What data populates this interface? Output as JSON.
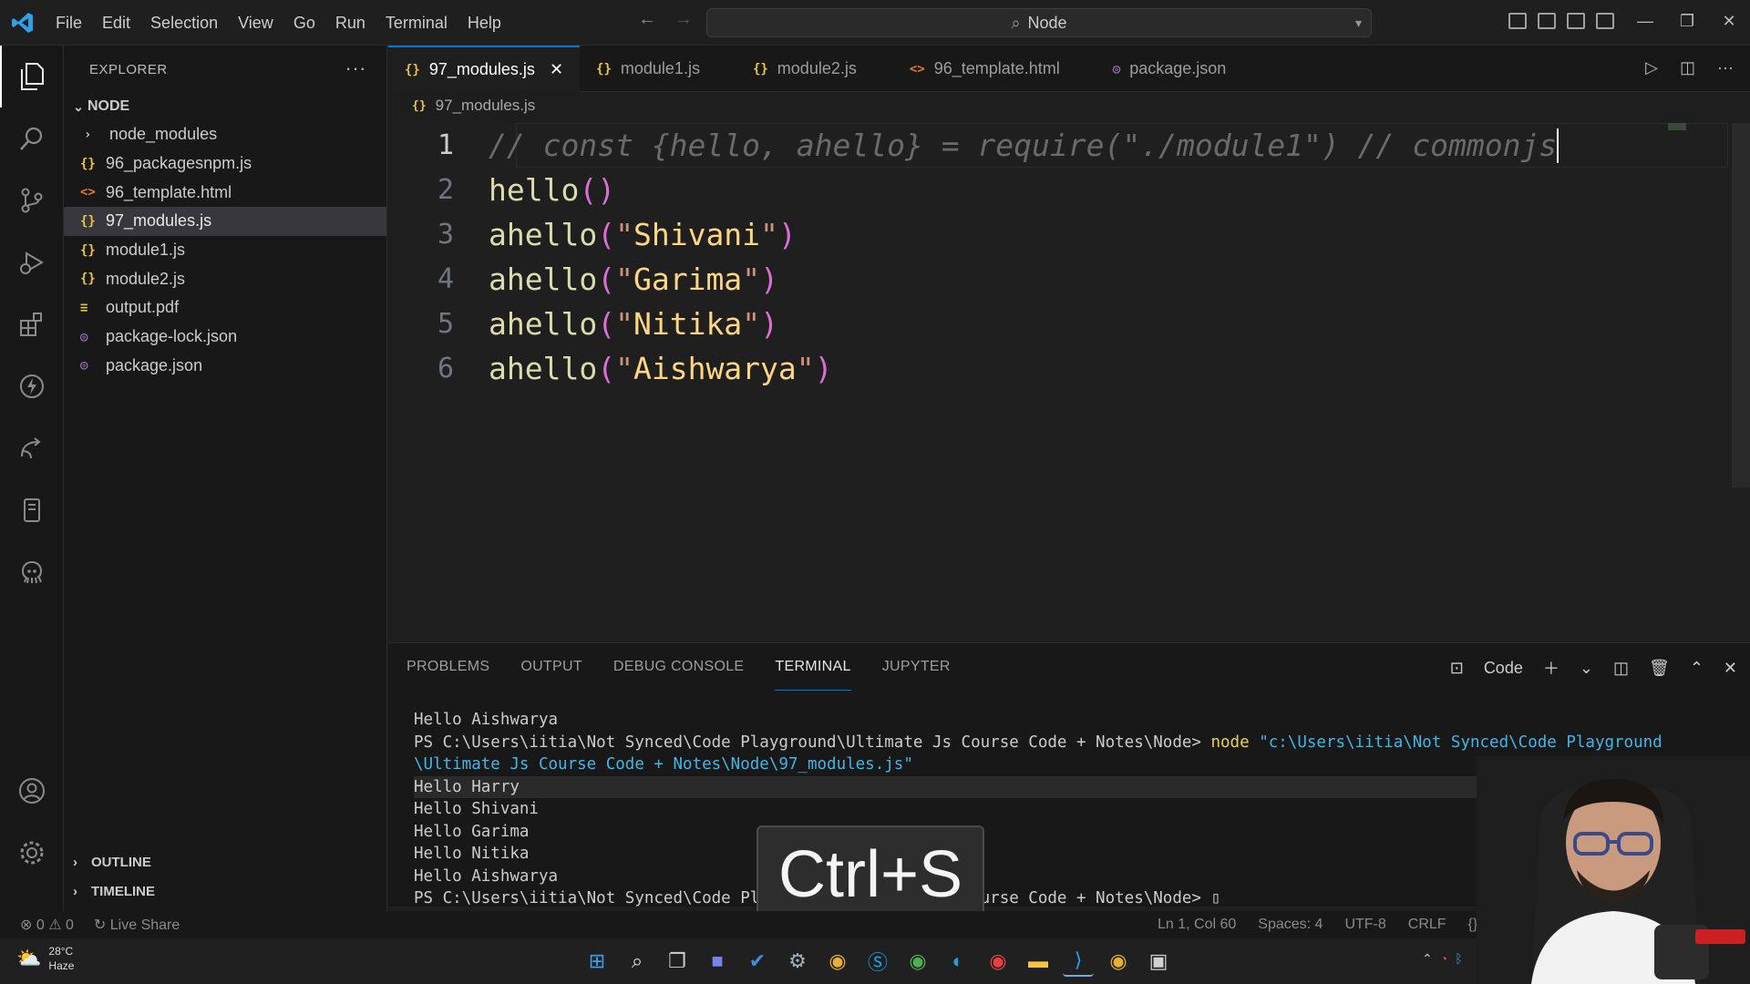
{
  "titlebar": {
    "menu": [
      "File",
      "Edit",
      "Selection",
      "View",
      "Go",
      "Run",
      "Terminal",
      "Help"
    ],
    "command_center": "Node"
  },
  "sidebar": {
    "title": "EXPLORER",
    "folder": "NODE",
    "items": [
      {
        "label": "node_modules",
        "type": "folder"
      },
      {
        "label": "96_packagesnpm.js",
        "type": "js"
      },
      {
        "label": "96_template.html",
        "type": "html"
      },
      {
        "label": "97_modules.js",
        "type": "js"
      },
      {
        "label": "module1.js",
        "type": "js"
      },
      {
        "label": "module2.js",
        "type": "js"
      },
      {
        "label": "output.pdf",
        "type": "pdf"
      },
      {
        "label": "package-lock.json",
        "type": "json"
      },
      {
        "label": "package.json",
        "type": "json"
      }
    ],
    "outline": "OUTLINE",
    "timeline": "TIMELINE"
  },
  "tabs": [
    {
      "label": "97_modules.js",
      "icon": "js-icon"
    },
    {
      "label": "module1.js",
      "icon": "js-icon"
    },
    {
      "label": "module2.js",
      "icon": "js-icon"
    },
    {
      "label": "96_template.html",
      "icon": "html-icon"
    },
    {
      "label": "package.json",
      "icon": "json-icon"
    }
  ],
  "breadcrumb": "97_modules.js",
  "editor": {
    "line_numbers": [
      "1",
      "2",
      "3",
      "4",
      "5",
      "6"
    ],
    "line1_comment": "// const {hello, ahello} = require(\"./module1\") // commonjs",
    "fn_hello": "hello",
    "fn_ahello": "ahello",
    "args": [
      "Shivani",
      "Garima",
      "Nitika",
      "Aishwarya"
    ]
  },
  "panel": {
    "tabs": [
      "PROBLEMS",
      "OUTPUT",
      "DEBUG CONSOLE",
      "TERMINAL",
      "JUPYTER"
    ],
    "shell": "Code",
    "terminal": {
      "line0": "Hello Aishwarya",
      "prompt": "PS C:\\Users\\iitia\\Not Synced\\Code Playground\\Ultimate Js Course Code + Notes\\Node> ",
      "cmd": "node",
      "arg_line1": "\"c:\\Users\\iitia\\Not Synced\\Code Playground",
      "arg_line2": "\\Ultimate Js Course Code + Notes\\Node\\97_modules.js\"",
      "outputs": [
        "Hello Harry",
        "Hello Shivani",
        "Hello Garima",
        "Hello Nitika",
        "Hello Aishwarya"
      ],
      "final_prompt": "PS C:\\Users\\iitia\\Not Synced\\Code Playground\\Ultimate Js Course Code + Notes\\Node> "
    }
  },
  "keycast": "Ctrl+S",
  "statusbar": {
    "errors": "0",
    "warnings": "0",
    "live_share": "Live Share",
    "position": "Ln 1, Col 60",
    "spaces": "Spaces: 4",
    "encoding": "UTF-8",
    "eol": "CRLF",
    "lang": "{}"
  },
  "taskbar": {
    "temp": "28°C",
    "weather": "Haze"
  },
  "colors": {
    "accent": "#0078d4",
    "js_icon": "#e8c547",
    "html_icon": "#e37933",
    "json_icon": "#a074c4"
  }
}
